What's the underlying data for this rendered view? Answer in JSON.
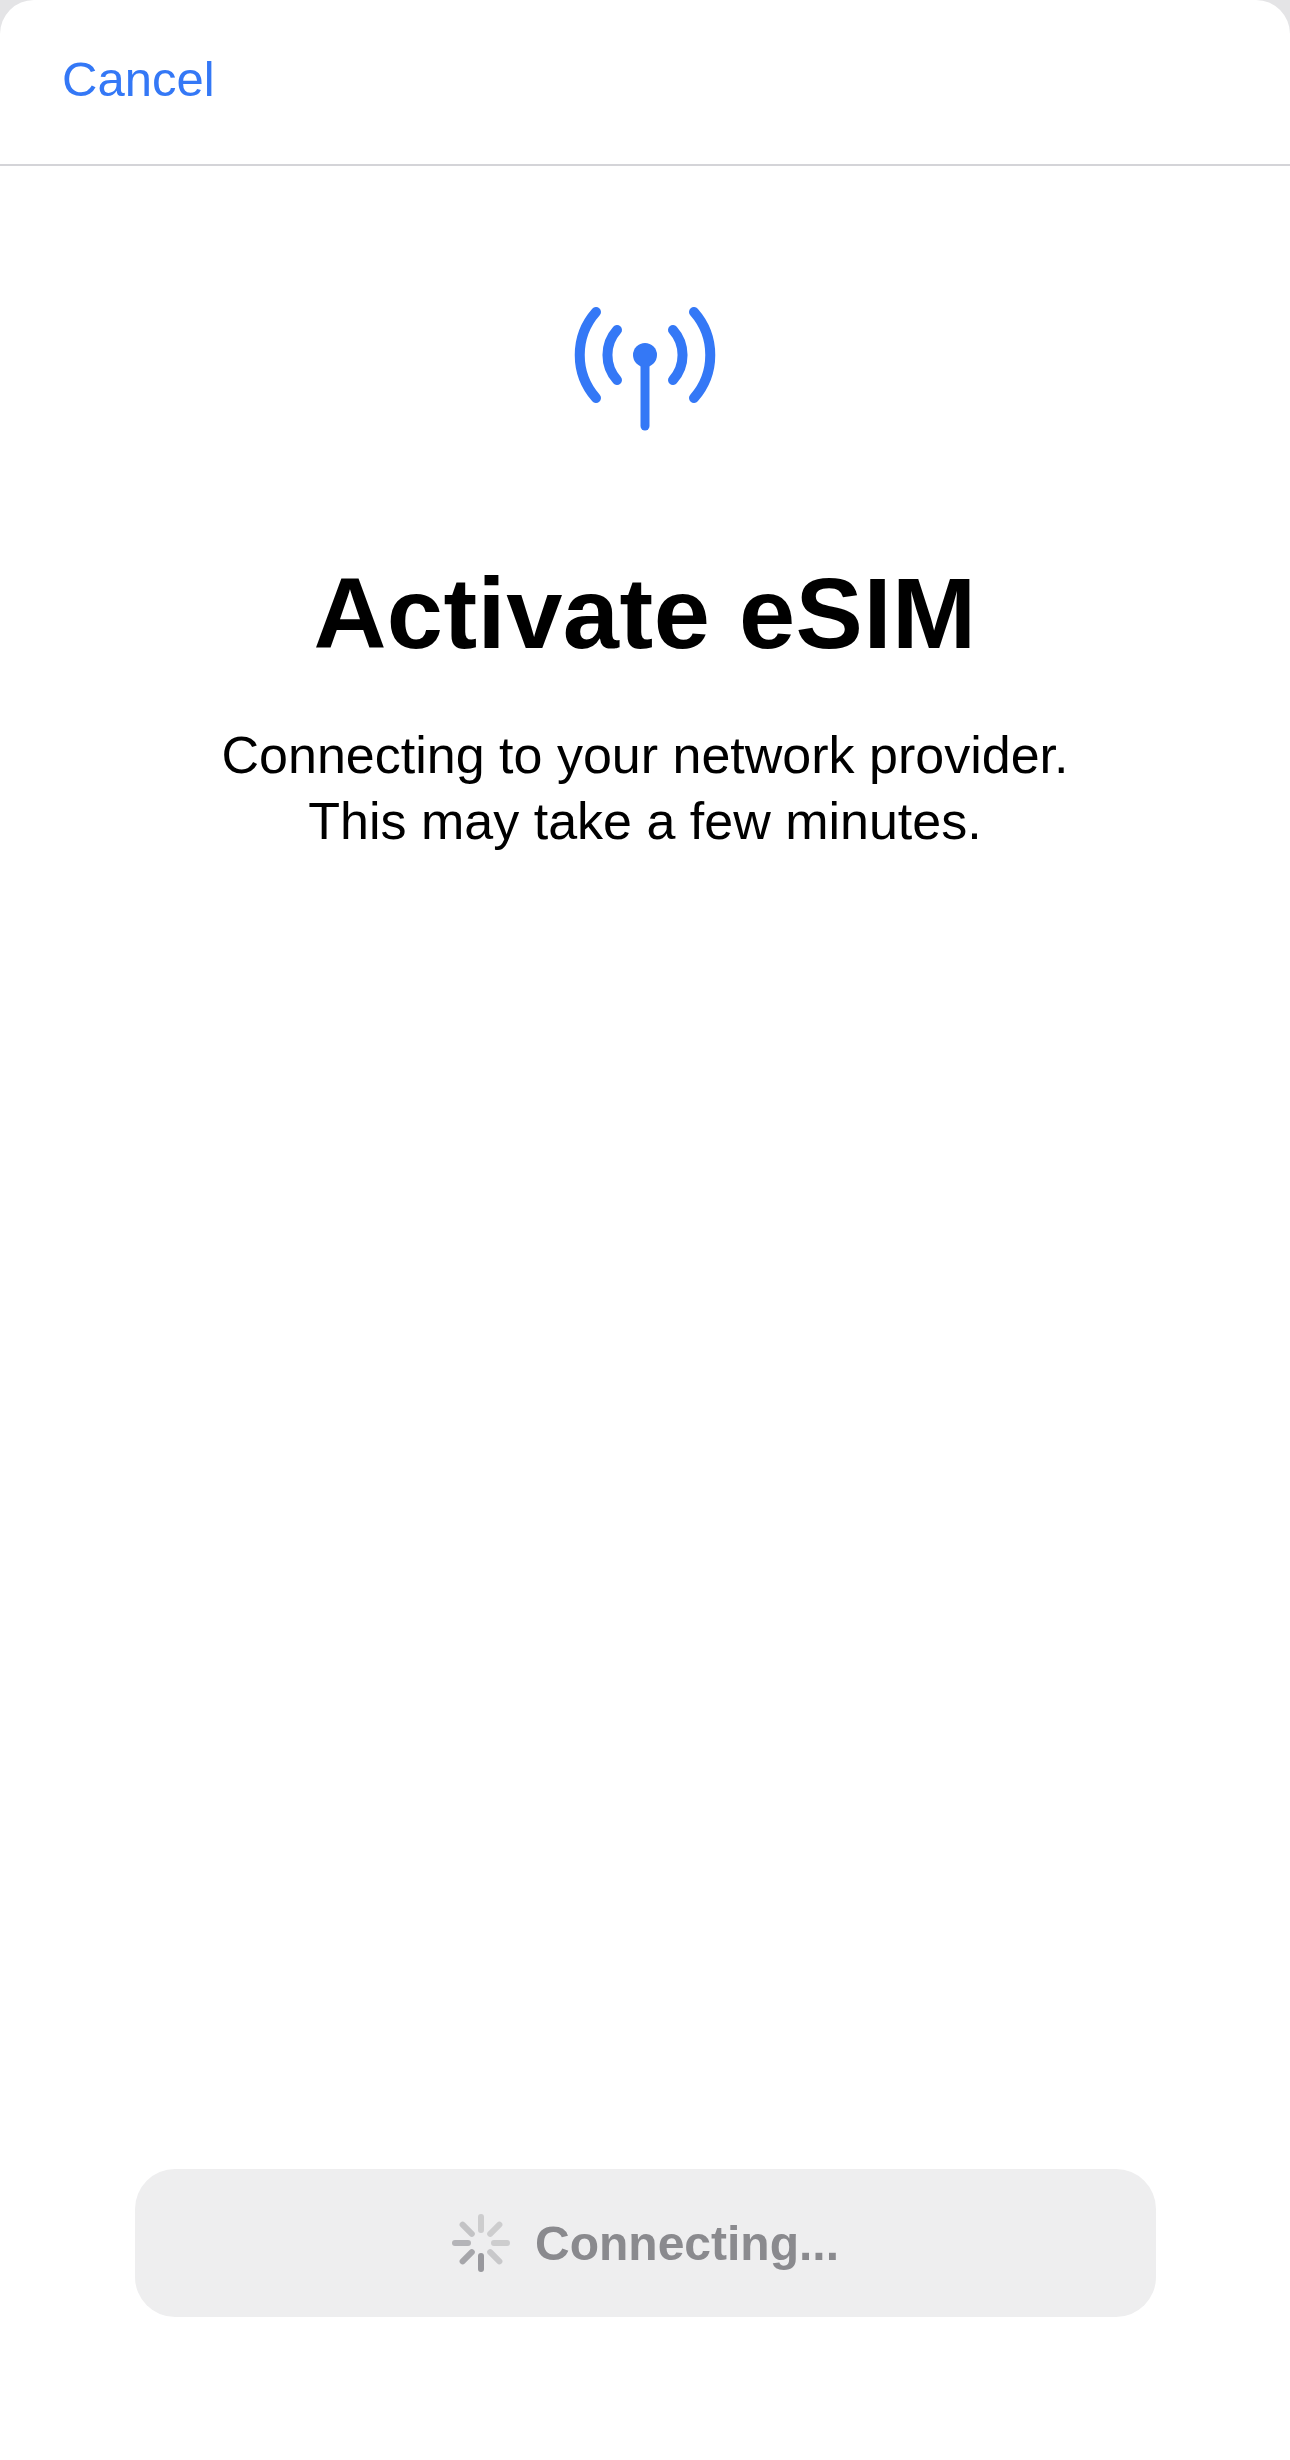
{
  "navigation": {
    "cancel": {
      "label": "Cancel"
    }
  },
  "header": {
    "title": "Activate eSIM",
    "subtitle": "Connecting to your network provider. This may take a few minutes."
  },
  "action_button": {
    "label": "Connecting...",
    "disabled": true,
    "loading": true
  }
}
